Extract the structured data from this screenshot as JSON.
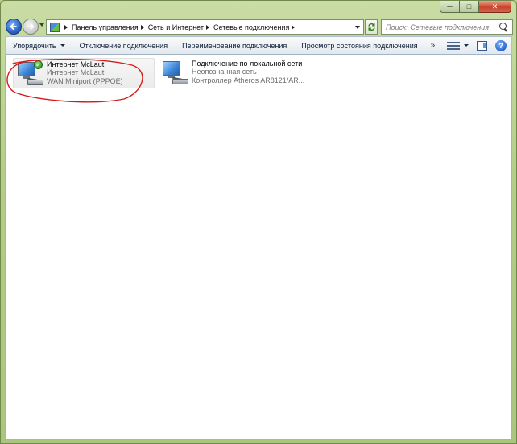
{
  "window": {
    "caption": {
      "minimize": "─",
      "maximize": "□",
      "close": "✕"
    }
  },
  "navigation": {
    "breadcrumb": [
      "Панель управления",
      "Сеть и Интернет",
      "Сетевые подключения"
    ],
    "search_placeholder": "Поиск: Сетевые подключения"
  },
  "toolbar": {
    "organize": "Упорядочить",
    "disable": "Отключение подключения",
    "rename": "Переименование подключения",
    "view_status": "Просмотр состояния подключения",
    "more": "»",
    "help": "?"
  },
  "connections": [
    {
      "name": "Интернет McLaut",
      "status": "Интернет McLaut",
      "device": "WAN Miniport (PPPOE)",
      "selected": true,
      "connected": true
    },
    {
      "name": "Подключение по локальной сети",
      "status": "Неопознанная сеть",
      "device": "Контроллер Atheros AR8121/AR...",
      "selected": false,
      "connected": false
    }
  ],
  "icons": {
    "back": "back-arrow-icon",
    "forward": "forward-arrow-icon",
    "address": "control-panel-icon",
    "refresh": "refresh-icon",
    "search": "search-icon",
    "views": "change-view-icon",
    "preview_pane": "preview-pane-icon",
    "help": "help-icon",
    "connection": "network-connection-icon",
    "connected_badge": "check-icon"
  },
  "colors": {
    "annotation": "#d31b1b",
    "content_bg": "#ffffff",
    "window_frame": "#b4cd88"
  }
}
